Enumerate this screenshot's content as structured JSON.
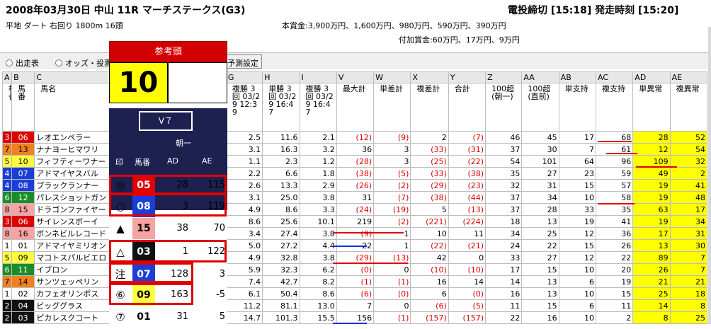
{
  "header": {
    "title": "2008年03月30日 中山 11R マーチステークス(G3)",
    "deadline": "電投締切 [15:18] 発走時刻 [15:20]",
    "info": "平地 ダート 右回り 1800m 16頭",
    "prize1": "本賞金:3,900万円、1,600万円、980万円、590万円、390万円",
    "prize2": "付加賞金:60万円、17万円、9万円"
  },
  "toolbar": {
    "radio1": "出走表",
    "radio2": "オッズ・投票",
    "button": "予測設定"
  },
  "overlay": {
    "title": "参考頭",
    "number": "10",
    "v7": "V７",
    "asa": "朝一",
    "col_mark": "印",
    "col_num": "馬番",
    "col_ad": "AD",
    "col_ae": "AE",
    "picks": [
      {
        "mark": "◎",
        "num": "05",
        "ad": "28",
        "ae": "115",
        "color": "#e00000"
      },
      {
        "mark": "○",
        "num": "08",
        "ad": "3",
        "ae": "119",
        "color": "#1b3fd6"
      },
      {
        "mark": "▲",
        "num": "15",
        "ad": "38",
        "ae": "70",
        "color": "#f7a3a3"
      },
      {
        "mark": "△",
        "num": "03",
        "ad": "1",
        "ae": "122",
        "color": "#111111"
      },
      {
        "mark": "注",
        "num": "07",
        "ad": "128",
        "ae": "3",
        "color": "#1b3fd6"
      },
      {
        "mark": "⑥",
        "num": "09",
        "ad": "163",
        "ae": "-5",
        "color": "#ffff40"
      },
      {
        "mark": "⑦",
        "num": "01",
        "ad": "31",
        "ae": "5",
        "color": "#ffffff"
      }
    ]
  },
  "table": {
    "col_letters": [
      "A",
      "B",
      "C",
      "G",
      "H",
      "I",
      "V",
      "W",
      "X",
      "Y",
      "Z",
      "AA",
      "AB",
      "AC",
      "AD",
      "AE"
    ],
    "headers": [
      "枠番",
      "馬番",
      "馬名",
      "複勝 3回 03/29 12:39",
      "単勝 3回 03/29 16:47",
      "複勝 3回 03/29 16:47",
      "最大計",
      "単差計",
      "複差計",
      "合計",
      "100超(朝一)",
      "100超(直前)",
      "単支持",
      "複支持",
      "単異常",
      "複異常"
    ],
    "rows": [
      {
        "waku": "3",
        "uma": "06",
        "name": "レオエンペラー",
        "g": "2.5",
        "h": "11.6",
        "i": "2.1",
        "v": "(12)",
        "w": "(9)",
        "x": "2",
        "y": "(7)",
        "z": "46",
        "aa": "45",
        "ab": "17",
        "ac": "68",
        "ad": "28",
        "ae": "52"
      },
      {
        "waku": "7",
        "uma": "13",
        "name": "ナナヨーヒマワリ",
        "g": "3.1",
        "h": "16.3",
        "i": "3.2",
        "v": "36",
        "w": "3",
        "x": "(33)",
        "y": "(31)",
        "z": "37",
        "aa": "30",
        "ab": "7",
        "ac": "61",
        "ad": "12",
        "ae": "54"
      },
      {
        "waku": "5",
        "uma": "10",
        "name": "フィフティーワナー",
        "g": "1.1",
        "h": "2.3",
        "i": "1.2",
        "v": "(28)",
        "w": "3",
        "x": "(25)",
        "y": "(22)",
        "z": "54",
        "aa": "101",
        "ab": "64",
        "ac": "96",
        "ad": "109",
        "ae": "32"
      },
      {
        "waku": "4",
        "uma": "07",
        "name": "アドマイヤスバル",
        "g": "2.2",
        "h": "6.6",
        "i": "1.8",
        "v": "(38)",
        "w": "(5)",
        "x": "(33)",
        "y": "(38)",
        "z": "35",
        "aa": "27",
        "ab": "23",
        "ac": "59",
        "ad": "49",
        "ae": "2"
      },
      {
        "waku": "4",
        "uma": "08",
        "name": "ブラックランナー",
        "g": "2.6",
        "h": "13.3",
        "i": "2.9",
        "v": "(26)",
        "w": "(2)",
        "x": "(29)",
        "y": "(23)",
        "z": "32",
        "aa": "31",
        "ab": "15",
        "ac": "57",
        "ad": "19",
        "ae": "41"
      },
      {
        "waku": "6",
        "uma": "12",
        "name": "パレスショットガン",
        "g": "3.1",
        "h": "25.0",
        "i": "3.8",
        "v": "31",
        "w": "(7)",
        "x": "(38)",
        "y": "(44)",
        "z": "37",
        "aa": "34",
        "ab": "10",
        "ac": "58",
        "ad": "19",
        "ae": "48"
      },
      {
        "waku": "8",
        "uma": "15",
        "name": "ドラゴンファイヤー",
        "g": "4.9",
        "h": "8.6",
        "i": "3.3",
        "v": "(24)",
        "w": "(19)",
        "x": "5",
        "y": "(13)",
        "z": "37",
        "aa": "28",
        "ab": "33",
        "ac": "35",
        "ad": "63",
        "ae": "17"
      },
      {
        "waku": "3",
        "uma": "06",
        "name": "サイレンスボーイ",
        "g": "8.6",
        "h": "25.6",
        "i": "10.1",
        "v": "219",
        "w": "(2)",
        "x": "(221)",
        "y": "(224)",
        "z": "18",
        "aa": "13",
        "ab": "19",
        "ac": "41",
        "ad": "19",
        "ae": "34"
      },
      {
        "waku": "8",
        "uma": "16",
        "name": "ボンネビルレコード",
        "g": "3.4",
        "h": "27.4",
        "i": "3.8",
        "v": "(9)",
        "w": "1",
        "x": "10",
        "y": "11",
        "z": "34",
        "aa": "25",
        "ab": "12",
        "ac": "36",
        "ad": "17",
        "ae": "31"
      },
      {
        "waku": "1",
        "uma": "01",
        "name": "アドマイヤミリオン",
        "g": "5.0",
        "h": "27.2",
        "i": "4.4",
        "v": "22",
        "w": "1",
        "x": "(22)",
        "y": "(21)",
        "z": "24",
        "aa": "22",
        "ab": "15",
        "ac": "26",
        "ad": "13",
        "ae": "30"
      },
      {
        "waku": "5",
        "uma": "09",
        "name": "マコトスパルビエロ",
        "g": "4.9",
        "h": "32.8",
        "i": "3.8",
        "v": "(29)",
        "w": "(13)",
        "x": "42",
        "y": "0",
        "z": "33",
        "aa": "27",
        "ab": "12",
        "ac": "22",
        "ad": "89",
        "ae": "7"
      },
      {
        "waku": "6",
        "uma": "11",
        "name": "イブロン",
        "g": "5.9",
        "h": "32.3",
        "i": "6.2",
        "v": "(0)",
        "w": "0",
        "x": "(10)",
        "y": "(10)",
        "z": "17",
        "aa": "15",
        "ab": "10",
        "ac": "20",
        "ad": "26",
        "ae": "7"
      },
      {
        "waku": "7",
        "uma": "14",
        "name": "サンツェッペリン",
        "g": "7.4",
        "h": "42.7",
        "i": "8.2",
        "v": "(1)",
        "w": "(1)",
        "x": "16",
        "y": "14",
        "z": "14",
        "aa": "13",
        "ab": "6",
        "ac": "19",
        "ad": "21",
        "ae": "21"
      },
      {
        "waku": "1",
        "uma": "02",
        "name": "カフェオリンポス",
        "g": "6.1",
        "h": "50.4",
        "i": "8.6",
        "v": "(6)",
        "w": "(0)",
        "x": "6",
        "y": "(0)",
        "z": "16",
        "aa": "13",
        "ab": "10",
        "ac": "15",
        "ad": "25",
        "ae": "18"
      },
      {
        "waku": "2",
        "uma": "04",
        "name": "ビッググラス",
        "g": "11.2",
        "h": "81.1",
        "i": "13.0",
        "v": "7",
        "w": "0",
        "x": "(6)",
        "y": "(5)",
        "z": "11",
        "aa": "15",
        "ab": "6",
        "ac": "11",
        "ad": "14",
        "ae": "8"
      },
      {
        "waku": "2",
        "uma": "03",
        "name": "ピカレスクコート",
        "g": "14.7",
        "h": "101.3",
        "i": "15.5",
        "v": "156",
        "w": "(1)",
        "x": "(157)",
        "y": "(157)",
        "z": "22",
        "aa": "16",
        "ab": "10",
        "ac": "2",
        "ad": "8",
        "ae": "25"
      }
    ]
  }
}
